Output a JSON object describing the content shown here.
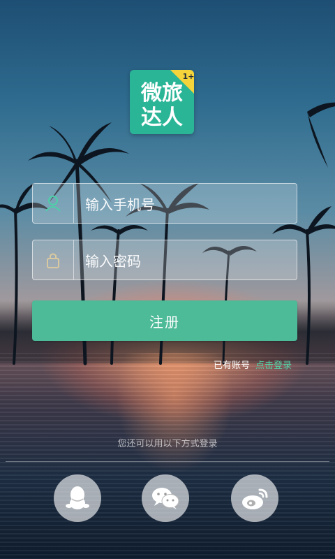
{
  "logo": {
    "line1": "微旅",
    "line2": "达人",
    "badge": "1+",
    "color": "#2bb597"
  },
  "form": {
    "phone_placeholder": "输入手机号",
    "password_placeholder": "输入密码",
    "phone_icon": "user-icon",
    "password_icon": "lock-icon",
    "submit_label": "注册",
    "submit_color": "#4dba98"
  },
  "login_prompt": {
    "text": "已有账号",
    "link": "点击登录",
    "link_color": "#55d3a8"
  },
  "alt_login": {
    "text": "您还可以用以下方式登录",
    "options": [
      {
        "label": "QQ",
        "icon": "qq-icon"
      },
      {
        "label": "WeChat",
        "icon": "wechat-icon"
      },
      {
        "label": "Weibo",
        "icon": "weibo-icon"
      }
    ]
  }
}
